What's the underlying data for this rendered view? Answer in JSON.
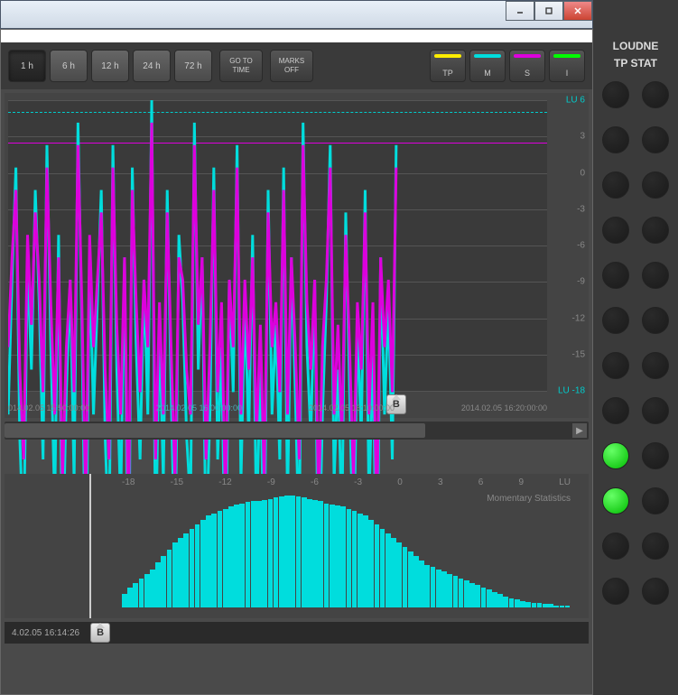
{
  "window": {
    "minimize": "–",
    "maximize": "□",
    "close": "×"
  },
  "toolbar": {
    "times": [
      "1 h",
      "6 h",
      "12 h",
      "24 h",
      "72 h"
    ],
    "active_time_index": 0,
    "goto": "GO TO\nTIME",
    "marks": "MARKS\nOFF",
    "channels": [
      {
        "label": "TP",
        "color": "#ffee00"
      },
      {
        "label": "M",
        "color": "#00dddd"
      },
      {
        "label": "S",
        "color": "#dd00dd"
      },
      {
        "label": "I",
        "color": "#00ff00"
      }
    ]
  },
  "chart_data": {
    "type": "line",
    "ylim": [
      -18,
      6
    ],
    "y_ticks": [
      {
        "v": 6,
        "label": "LU 6",
        "highlight": true
      },
      {
        "v": 3,
        "label": "3"
      },
      {
        "v": 0,
        "label": "0"
      },
      {
        "v": -3,
        "label": "-3"
      },
      {
        "v": -6,
        "label": "-6"
      },
      {
        "v": -9,
        "label": "-9"
      },
      {
        "v": -12,
        "label": "-12"
      },
      {
        "v": -15,
        "label": "-15"
      },
      {
        "v": -18,
        "label": "LU -18",
        "highlight": true
      }
    ],
    "x_ticks": [
      "014.02.05 15:50:00:00",
      "2014.02.05 16:00:00:00",
      "2014.02.05 16:10:00:00",
      "2014.02.05 16:20:00:00"
    ],
    "threshold_magenta": 2.5,
    "threshold_cyan_dashed": 5,
    "marker_b_x_pct": 72,
    "series": [
      {
        "name": "M",
        "color": "#00dddd",
        "values": [
          -8,
          -2,
          3,
          -9,
          -14,
          -1,
          -6,
          2,
          -3,
          -10,
          4,
          -5,
          -12,
          0,
          -15,
          -7,
          -2,
          -11,
          5,
          -4,
          -16,
          -1,
          -8,
          -3,
          2,
          -9,
          -14,
          4,
          -6,
          -12,
          -1,
          -17,
          3,
          -5,
          -10,
          -2,
          -8,
          6,
          -14,
          -4,
          -11,
          2,
          -7,
          -15,
          0,
          -3,
          -9,
          -12,
          5,
          -6,
          -1,
          -14,
          -8,
          3,
          -10,
          -5,
          -16,
          -2,
          -7,
          4,
          -11,
          -3,
          -9,
          0,
          -13,
          -6,
          -15,
          2,
          -8,
          -4,
          -10,
          3,
          -12,
          -1,
          -7,
          -14,
          5,
          -5,
          -9,
          -2,
          -16,
          -8,
          -3,
          4,
          -11,
          -6,
          -13,
          1,
          -7,
          -15,
          -4,
          -9,
          2,
          -12,
          -5,
          -17,
          -1,
          -8,
          -3,
          -10,
          4
        ]
      },
      {
        "name": "S",
        "color": "#dd00dd",
        "values": [
          -5,
          -1,
          2,
          -6,
          -10,
          0,
          -4,
          1,
          -2,
          -7,
          3,
          -3,
          -8,
          -1,
          -11,
          -5,
          -2,
          -7,
          4,
          -3,
          -12,
          0,
          -5,
          -2,
          1,
          -6,
          -10,
          3,
          -4,
          -8,
          -1,
          -13,
          2,
          -3,
          -7,
          -2,
          -5,
          5,
          -10,
          -3,
          -8,
          1,
          -5,
          -11,
          -1,
          -2,
          -6,
          -8,
          4,
          -4,
          -1,
          -10,
          -5,
          2,
          -7,
          -3,
          -12,
          -2,
          -5,
          3,
          -8,
          -2,
          -6,
          -1,
          -9,
          -4,
          -11,
          1,
          -5,
          -3,
          -7,
          2,
          -8,
          -1,
          -5,
          -10,
          4,
          -3,
          -6,
          -2,
          -12,
          -5,
          -2,
          3,
          -8,
          -4,
          -9,
          0,
          -5,
          -11,
          -3,
          -6,
          1,
          -8,
          -3,
          -13,
          -1,
          -5,
          -2,
          -7,
          3
        ]
      }
    ],
    "series_stop_pct": 72,
    "histogram": {
      "title": "Momentary Statistics",
      "xlabel_suffix": "LU",
      "x_ticks": [
        -18,
        -15,
        -12,
        -9,
        -6,
        -3,
        0,
        3,
        6,
        9
      ],
      "x_range": [
        -18,
        10
      ],
      "values": [
        12,
        18,
        22,
        26,
        30,
        34,
        40,
        46,
        52,
        58,
        62,
        66,
        70,
        74,
        78,
        82,
        84,
        86,
        88,
        90,
        92,
        93,
        94,
        95,
        95,
        96,
        97,
        98,
        99,
        100,
        100,
        99,
        98,
        97,
        96,
        95,
        93,
        92,
        91,
        90,
        88,
        86,
        84,
        82,
        78,
        74,
        70,
        66,
        62,
        58,
        54,
        50,
        46,
        42,
        38,
        36,
        34,
        32,
        30,
        28,
        26,
        24,
        22,
        20,
        18,
        16,
        14,
        12,
        10,
        8,
        7,
        6,
        5,
        4,
        4,
        3,
        3,
        2,
        2,
        2
      ]
    }
  },
  "footer": {
    "timestamp": "4.02.05 16:14:26",
    "marker": "B"
  },
  "sidebar": {
    "title_line1": "LOUDNE",
    "title_line2": "TP STAT",
    "rows": [
      [
        false,
        false
      ],
      [
        false,
        false
      ],
      [
        false,
        false
      ],
      [
        false,
        false
      ],
      [
        false,
        false
      ],
      [
        false,
        false
      ],
      [
        false,
        false
      ],
      [
        false,
        false
      ],
      [
        true,
        false
      ],
      [
        true,
        false
      ],
      [
        false,
        false
      ],
      [
        false,
        false
      ]
    ]
  }
}
